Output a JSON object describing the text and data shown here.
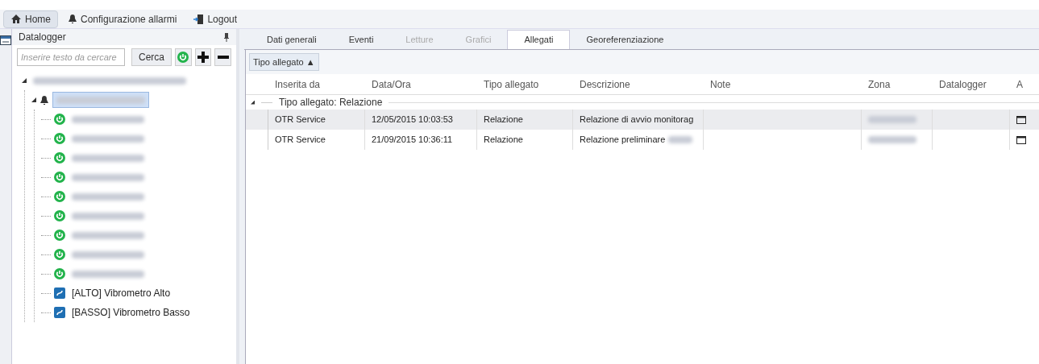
{
  "toolbar": [
    {
      "kind": "home",
      "label": "Home",
      "selected": true
    },
    {
      "kind": "bell",
      "label": "Configurazione allarmi",
      "selected": false
    },
    {
      "kind": "logout",
      "label": "Logout",
      "selected": false
    }
  ],
  "panel": {
    "title": "Datalogger",
    "search": {
      "placeholder": "Inserire testo da cercare"
    },
    "search_button": "Cerca"
  },
  "tree": [
    {
      "kind": "root",
      "expanded": true,
      "selected": false,
      "children": [
        {
          "kind": "bell",
          "expanded": true,
          "selected": true,
          "children": [
            {
              "kind": "power"
            },
            {
              "kind": "power"
            },
            {
              "kind": "power"
            },
            {
              "kind": "power"
            },
            {
              "kind": "power"
            },
            {
              "kind": "power"
            },
            {
              "kind": "power"
            },
            {
              "kind": "power"
            },
            {
              "kind": "power"
            },
            {
              "kind": "sensor",
              "label": "[ALTO] Vibrometro Alto"
            },
            {
              "kind": "sensor",
              "label": "[BASSO] Vibrometro Basso"
            }
          ]
        }
      ]
    }
  ],
  "tabs": [
    {
      "label": "Dati generali",
      "selected": false,
      "disabled": false
    },
    {
      "label": "Eventi",
      "selected": false,
      "disabled": false
    },
    {
      "label": "Letture",
      "selected": false,
      "disabled": true
    },
    {
      "label": "Grafici",
      "selected": false,
      "disabled": true
    },
    {
      "label": "Allegati",
      "selected": true,
      "disabled": false
    },
    {
      "label": "Georeferenziazione",
      "selected": false,
      "disabled": false
    }
  ],
  "group_by": "Tipo allegato ▲",
  "table": {
    "columns": [
      "Inserita da",
      "Data/Ora",
      "Tipo allegato",
      "Descrizione",
      "Note",
      "Zona",
      "Datalogger",
      "A"
    ],
    "group": {
      "label": "Tipo allegato: Relazione",
      "expanded": true
    },
    "rows": [
      {
        "selected": true,
        "cells": [
          "OTR Service",
          "12/05/2015 10:03:53",
          "Relazione",
          "Relazione di avvio monitorag"
        ]
      },
      {
        "selected": false,
        "cells": [
          "OTR Service",
          "21/09/2015 10:36:11",
          "Relazione",
          "Relazione preliminare"
        ]
      }
    ]
  }
}
